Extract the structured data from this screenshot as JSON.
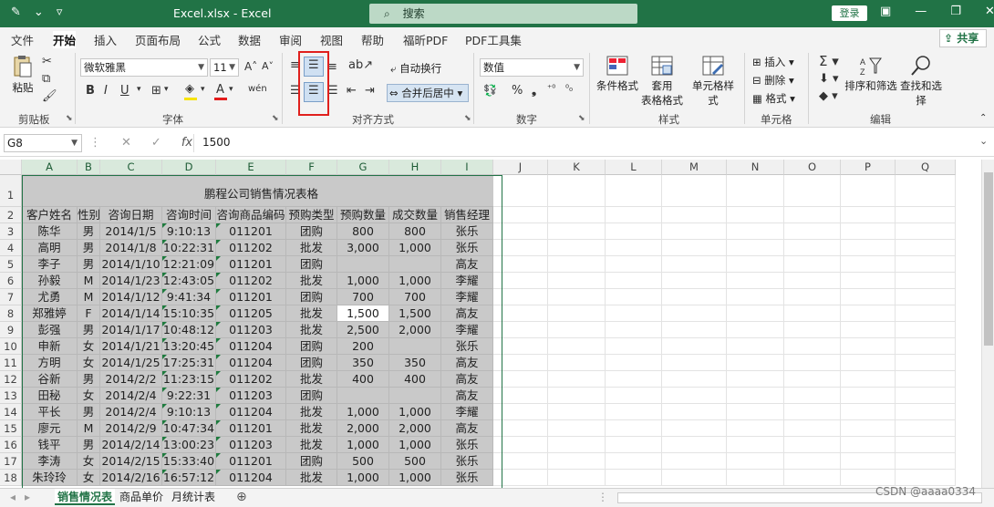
{
  "titlebar": {
    "filename": "Excel.xlsx  -  Excel",
    "search_placeholder": "搜索",
    "login": "登录"
  },
  "tabs": [
    "文件",
    "开始",
    "插入",
    "页面布局",
    "公式",
    "数据",
    "审阅",
    "视图",
    "帮助",
    "福昕PDF",
    "PDF工具集"
  ],
  "active_tab": "开始",
  "share": "共享",
  "ribbon": {
    "paste": "粘贴",
    "clipboard": "剪贴板",
    "font_name": "微软雅黑",
    "font_size": "11",
    "font_group": "字体",
    "bold": "B",
    "italic": "I",
    "underline": "U",
    "wrap_text": "自动换行",
    "merge_center": "合并后居中",
    "align_group": "对齐方式",
    "number_format": "数值",
    "number_group": "数字",
    "conditional_format": "条件格式",
    "table_format_1": "套用",
    "table_format_2": "表格格式",
    "cell_styles": "单元格样式",
    "styles_group": "样式",
    "insert": "插入",
    "delete": "删除",
    "format": "格式",
    "cells_group": "单元格",
    "sort_filter": "排序和筛选",
    "find_select": "查找和选择",
    "edit_group": "编辑"
  },
  "formula_bar": {
    "name_box": "G8",
    "fx": "fx",
    "value": "1500"
  },
  "columns": [
    "A",
    "B",
    "C",
    "D",
    "E",
    "F",
    "G",
    "H",
    "I",
    "J",
    "K",
    "L",
    "M",
    "N",
    "O",
    "P",
    "Q"
  ],
  "sheet": {
    "title": "鹏程公司销售情况表格",
    "headers": [
      "客户姓名",
      "性别",
      "咨询日期",
      "咨询时间",
      "咨询商品编码",
      "预购类型",
      "预购数量",
      "成交数量",
      "销售经理"
    ],
    "rows": [
      [
        "陈华",
        "男",
        "2014/1/5",
        "9:10:13",
        "011201",
        "团购",
        "800",
        "800",
        "张乐"
      ],
      [
        "高明",
        "男",
        "2014/1/8",
        "10:22:31",
        "011202",
        "批发",
        "3,000",
        "1,000",
        "张乐"
      ],
      [
        "李子",
        "男",
        "2014/1/10",
        "12:21:09",
        "011201",
        "团购",
        "",
        "",
        "高友"
      ],
      [
        "孙毅",
        "M",
        "2014/1/23",
        "12:43:05",
        "011202",
        "批发",
        "1,000",
        "1,000",
        "李耀"
      ],
      [
        "尤勇",
        "M",
        "2014/1/12",
        "9:41:34",
        "011201",
        "团购",
        "700",
        "700",
        "李耀"
      ],
      [
        "郑雅婷",
        "F",
        "2014/1/14",
        "15:10:35",
        "011205",
        "批发",
        "1,500",
        "1,500",
        "高友"
      ],
      [
        "彭强",
        "男",
        "2014/1/17",
        "10:48:12",
        "011203",
        "批发",
        "2,500",
        "2,000",
        "李耀"
      ],
      [
        "申新",
        "女",
        "2014/1/21",
        "13:20:45",
        "011204",
        "团购",
        "200",
        "",
        "张乐"
      ],
      [
        "方明",
        "女",
        "2014/1/25",
        "17:25:31",
        "011204",
        "团购",
        "350",
        "350",
        "高友"
      ],
      [
        "谷新",
        "男",
        "2014/2/2",
        "11:23:15",
        "011202",
        "批发",
        "400",
        "400",
        "高友"
      ],
      [
        "田秘",
        "女",
        "2014/2/4",
        "9:22:31",
        "011203",
        "团购",
        "",
        "",
        "高友"
      ],
      [
        "平长",
        "男",
        "2014/2/4",
        "9:10:13",
        "011204",
        "批发",
        "1,000",
        "1,000",
        "李耀"
      ],
      [
        "廖元",
        "M",
        "2014/2/9",
        "10:47:34",
        "011201",
        "批发",
        "2,000",
        "2,000",
        "高友"
      ],
      [
        "钱平",
        "男",
        "2014/2/14",
        "13:00:23",
        "011203",
        "批发",
        "1,000",
        "1,000",
        "张乐"
      ],
      [
        "李涛",
        "女",
        "2014/2/15",
        "15:33:40",
        "011201",
        "团购",
        "500",
        "500",
        "张乐"
      ],
      [
        "朱玲玲",
        "女",
        "2014/2/16",
        "16:57:12",
        "011204",
        "批发",
        "1,000",
        "1,000",
        "张乐"
      ]
    ]
  },
  "row_numbers": [
    "1",
    "2",
    "3",
    "4",
    "5",
    "6",
    "7",
    "8",
    "9",
    "10",
    "11",
    "12",
    "13",
    "14",
    "15",
    "16",
    "17",
    "18"
  ],
  "sheet_tabs": [
    "销售情况表",
    "商品单价",
    "月统计表"
  ],
  "watermark": "CSDN @aaaa0334"
}
